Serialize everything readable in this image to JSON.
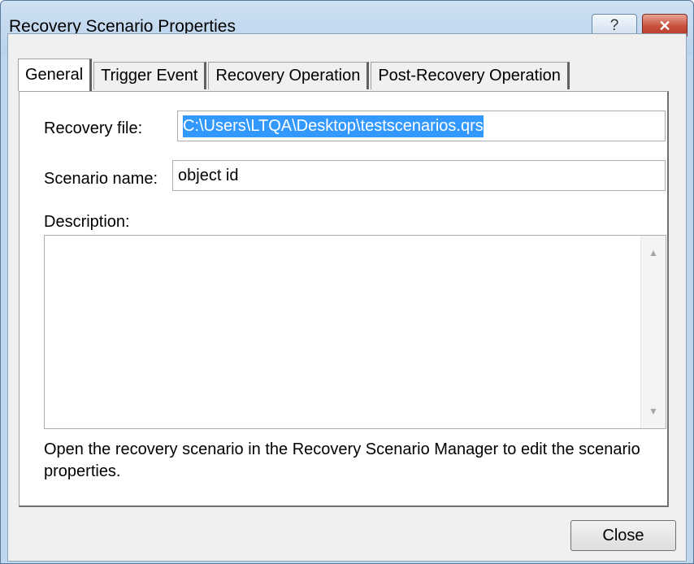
{
  "window": {
    "title": "Recovery Scenario Properties",
    "help_icon": "?",
    "close_icon": "✕"
  },
  "tabs": [
    {
      "label": "General",
      "active": true
    },
    {
      "label": "Trigger Event",
      "active": false
    },
    {
      "label": "Recovery Operation",
      "active": false
    },
    {
      "label": "Post-Recovery Operation",
      "active": false
    }
  ],
  "form": {
    "recovery_file_label": "Recovery file:",
    "recovery_file_value": "C:\\Users\\LTQA\\Desktop\\testscenarios.qrs",
    "scenario_name_label": "Scenario name:",
    "scenario_name_value": "object id",
    "description_label": "Description:",
    "description_value": ""
  },
  "note": "Open the recovery scenario in the Recovery Scenario Manager to edit the scenario properties.",
  "buttons": {
    "close": "Close"
  },
  "colors": {
    "selection": "#3399ff",
    "titlebar": "#bfd7ee",
    "close_x": "#c8513d"
  },
  "icons": {
    "scroll_up": "▲",
    "scroll_down": "▼"
  }
}
